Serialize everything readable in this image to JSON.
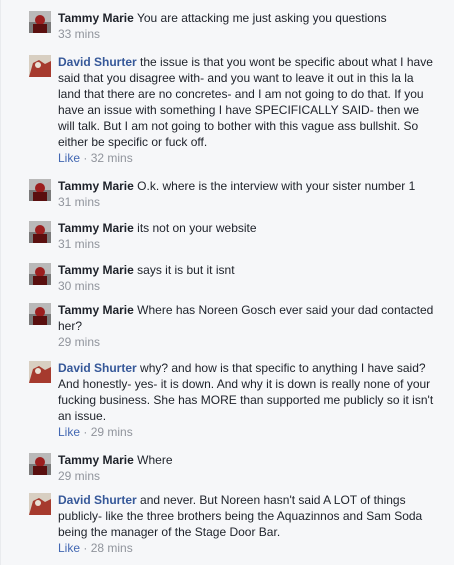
{
  "comments": [
    {
      "author": "Tammy Marie",
      "avatar": "tammy",
      "text": "You are attacking me just asking you questions",
      "time": "33 mins",
      "like": ""
    },
    {
      "author": "David Shurter",
      "avatar": "david",
      "text": "the issue is that you wont be specific about what I have said that you disagree with- and you want to leave it out in this la la land that there are no concretes- and I am not going to do that. If you have an issue with something I have SPECIFICALLY SAID- then we will talk. But I am not going to bother with this vague ass bullshit. So either be specific or fuck off.",
      "time": "32 mins",
      "like": "Like"
    },
    {
      "author": "Tammy Marie",
      "avatar": "tammy",
      "text": "O.k. where is the interview with your sister number 1",
      "time": "31 mins",
      "like": ""
    },
    {
      "author": "Tammy Marie",
      "avatar": "tammy",
      "text": "its not on your website",
      "time": "31 mins",
      "like": ""
    },
    {
      "author": "Tammy Marie",
      "avatar": "tammy",
      "text": "says it is but it isnt",
      "time": "30 mins",
      "like": ""
    },
    {
      "author": "Tammy Marie",
      "avatar": "tammy",
      "text": "Where has Noreen Gosch ever said your dad contacted her?",
      "time": "29 mins",
      "like": ""
    },
    {
      "author": "David Shurter",
      "avatar": "david",
      "text": "why? and how is that specific to anything I have said? And honestly- yes- it is down. And why it is down is really none of your fucking business. She has MORE than supported me publicly so it isn't an issue.",
      "time": "29 mins",
      "like": "Like"
    },
    {
      "author": "Tammy Marie",
      "avatar": "tammy",
      "text": "Where",
      "time": "29 mins",
      "like": ""
    },
    {
      "author": "David Shurter",
      "avatar": "david",
      "text": "and never. But Noreen hasn't said A LOT of things publicly- like the three brothers being the Aquazinnos and Sam Soda being the manager of the Stage Door Bar.",
      "time": "28 mins",
      "like": "Like"
    }
  ],
  "separator": " · "
}
